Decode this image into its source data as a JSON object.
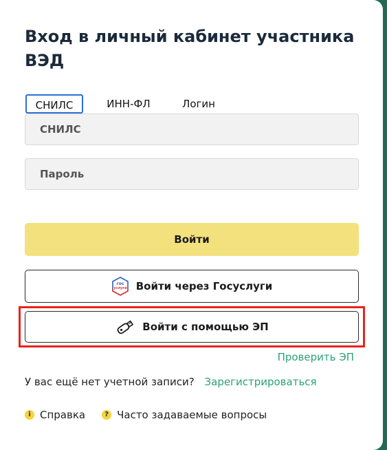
{
  "title": "Вход в личный кабинет участника ВЭД",
  "tabs": [
    {
      "label": "СНИЛС",
      "active": true
    },
    {
      "label": "ИНН-ФЛ",
      "active": false
    },
    {
      "label": "Логин",
      "active": false
    }
  ],
  "form": {
    "snils_placeholder": "СНИЛС",
    "password_placeholder": "Пароль"
  },
  "buttons": {
    "login": "Войти",
    "gosuslugi": "Войти через Госуслуги",
    "gos_icon_text_1": "гос",
    "gos_icon_text_2": "услуги",
    "ep": "Войти с помощью ЭП"
  },
  "links": {
    "check_ep": "Проверить ЭП",
    "no_account": "У вас ещё нет учетной записи?",
    "register": "Зарегистрироваться"
  },
  "footer": {
    "help": "Справка",
    "faq": "Часто задаваемые вопросы",
    "help_icon": "i",
    "faq_icon": "?"
  },
  "colors": {
    "accent_yellow": "#f3e17e",
    "link_green": "#2aa179",
    "highlight_red": "#e8231c",
    "tab_border_blue": "#2c6fd1"
  }
}
